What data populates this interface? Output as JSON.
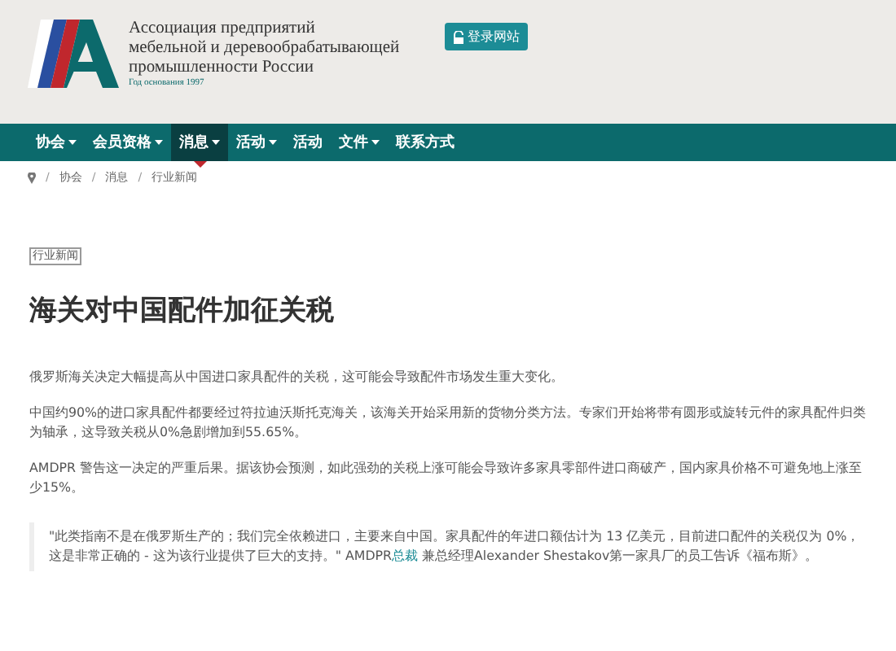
{
  "header": {
    "org_name": [
      "Ассоциация предприятий",
      "мебельной и деревообрабатывающей",
      "промышленности России"
    ],
    "founded": "Год основания 1997",
    "login_button": "登录网站"
  },
  "nav": [
    {
      "label": "协会",
      "dropdown": true,
      "selected": false
    },
    {
      "label": "会员资格",
      "dropdown": true,
      "selected": false
    },
    {
      "label": "消息",
      "dropdown": true,
      "selected": true
    },
    {
      "label": "活动",
      "dropdown": true,
      "selected": false
    },
    {
      "label": "活动",
      "dropdown": false,
      "selected": false
    },
    {
      "label": "文件",
      "dropdown": true,
      "selected": false
    },
    {
      "label": "联系方式",
      "dropdown": false,
      "selected": false
    }
  ],
  "breadcrumb_separator": "/",
  "breadcrumb": [
    "协会",
    "消息",
    "行业新闻"
  ],
  "article": {
    "tag": "行业新闻",
    "title": "海关对中国配件加征关税",
    "paragraphs": [
      "俄罗斯海关决定大幅提高从中国进口家具配件的关税，这可能会导致配件市场发生重大变化。",
      "中国约90%的进口家具配件都要经过符拉迪沃斯托克海关，该海关开始采用新的货物分类方法。专家们开始将带有圆形或旋转元件的家具配件归类为轴承，这导致关税从0%急剧增加到55.65%。",
      "AMDPR 警告这一决定的严重后果。据该协会预测，如此强劲的关税上涨可能会导致许多家具零部件进口商破产，国内家具价格不可避免地上涨至少15%。"
    ],
    "quote": {
      "before": "\"此类指南不是在俄罗斯生产的；我们完全依赖进口，主要来自中国。家具配件的年进口额估计为 13 亿美元，目前进口配件的关税仅为 0%，这是非常正确的 - 这为该行业提供了巨大的支持。\" AMDPR",
      "link": "总裁",
      "after": " 兼总经理Alexander Shestakov第一家具厂的员工告诉《福布斯》。"
    }
  }
}
